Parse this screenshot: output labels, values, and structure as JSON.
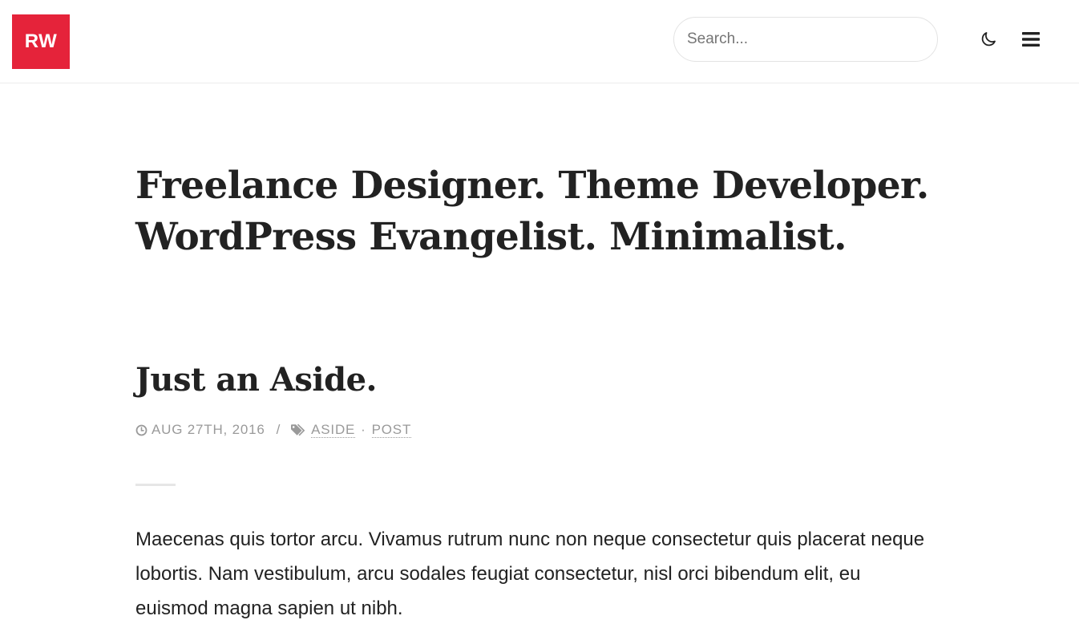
{
  "header": {
    "logo_text": "RW",
    "brand_color": "#e5233a",
    "search": {
      "placeholder": "Search...",
      "value": ""
    },
    "theme_toggle_icon": "moon-icon",
    "menu_icon": "hamburger-menu-icon"
  },
  "intro": {
    "line1": "Freelance Designer. Theme Developer.",
    "line2": "WordPress Evangelist. Minimalist."
  },
  "post": {
    "title": "Just an Aside.",
    "date": "AUG 27TH, 2016",
    "meta_separator": "/",
    "tag_separator": "·",
    "tags": [
      "ASIDE",
      "POST"
    ],
    "body": "Maecenas quis tortor arcu. Vivamus rutrum nunc non neque consectetur quis placerat neque lobortis. Nam vestibulum, arcu sodales feugiat consectetur, nisl orci bibendum elit, eu euismod magna sapien ut nibh."
  }
}
